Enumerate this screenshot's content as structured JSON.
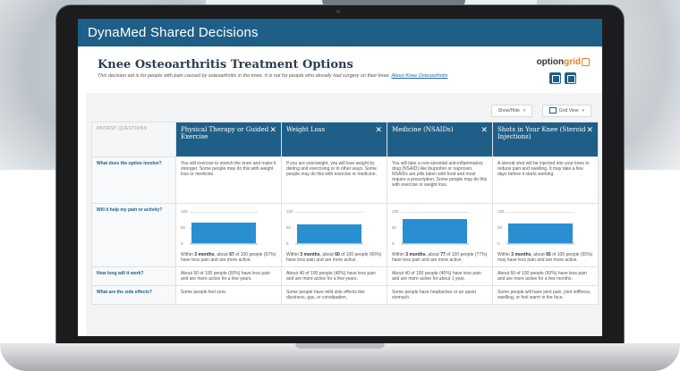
{
  "app": {
    "title": "DynaMed Shared Decisions"
  },
  "page": {
    "title": "Knee Osteoarthritis Treatment Options",
    "subtitle": "This decision aid is for people with pain caused by osteoarthritis in the knee. It is not for people who already had surgery on their knee.",
    "subtitle_link": "About Knee Osteoarthritis",
    "brand_prefix": "option",
    "brand_suffix": "grid"
  },
  "controls": {
    "show_hide": "Show/Hide",
    "grid_view": "Grid View"
  },
  "table": {
    "question_header": "PATIENT QUESTIONS",
    "columns": [
      "Physical Therapy or Guided Exercise",
      "Weight Loss",
      "Medicine (NSAIDs)",
      "Shots in Your Knee (Steroid Injections)"
    ],
    "rows": [
      {
        "question": "What does the option involve?",
        "cells": [
          "You will exercise to stretch the knee and make it stronger. Some people may do this with weight loss or medicine.",
          "If you are overweight, you will lose weight by dieting and exercising or in other ways. Some people may do this with exercise or medicine.",
          "You will take a non-steroidal anti-inflammatory drug (NSAID) like ibuprofen or naproxen. NSAIDs are pills taken with food and most require a prescription. Some people may do this with exercise or weight loss.",
          "A steroid shot will be injected into your knee to reduce pain and swelling. It may take a few days before it starts working."
        ]
      },
      {
        "question": "Will it help my pain or activity?",
        "chart_ticks": [
          "100",
          "50",
          "0"
        ],
        "cells": [
          {
            "value": 67,
            "months": "3 months",
            "count": "67",
            "text": "people (67%) have less pain and are more active."
          },
          {
            "value": 60,
            "months": "3 months",
            "count": "60",
            "text": "people (60%) have less pain and are more active."
          },
          {
            "value": 77,
            "months": "3 months",
            "count": "77",
            "text": "people (77%) have less pain and are more active."
          },
          {
            "value": 65,
            "months": "3 months",
            "count": "65",
            "text": "people (65%) may have less pain and are more active."
          }
        ]
      },
      {
        "question": "How long will it work?",
        "cells": [
          "About 50 of 100 people (50%) have less pain and are more active for a few years.",
          "About 40 of 100 people (40%) have less pain and are more active for a few years.",
          "About 40 of 100 people (40%) have less pain and are more active for about 1 year.",
          "About 60 of 100 people (60%) have less pain and are more active for a few months."
        ]
      },
      {
        "question": "What are the side effects?",
        "cells": [
          "Some people feel sore.",
          "Some people have mild side effects like dizziness, gas, or constipation.",
          "Some people have headaches or an upset stomach.",
          "Some people will have joint pain, joint stiffness, swelling, or feel warm in the face."
        ]
      }
    ]
  },
  "colors": {
    "header_bg": "#1f5f87",
    "bar": "#2a8fd0",
    "brand_accent": "#e67e22"
  }
}
